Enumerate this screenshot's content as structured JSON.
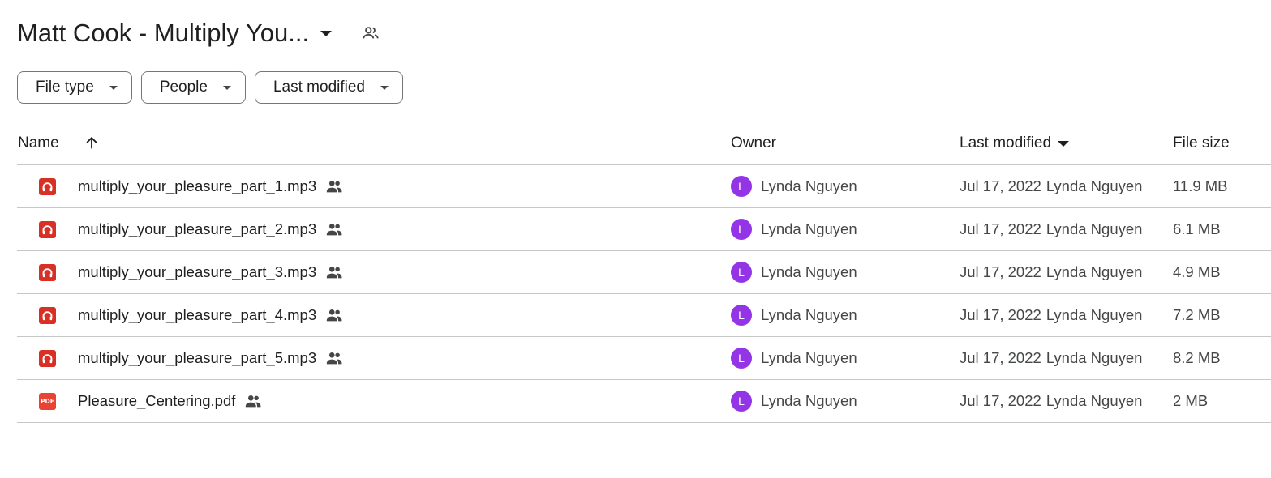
{
  "folder": {
    "title": "Matt Cook - Multiply You..."
  },
  "filters": {
    "file_type": "File type",
    "people": "People",
    "last_modified": "Last modified"
  },
  "columns": {
    "name": "Name",
    "owner": "Owner",
    "last_modified": "Last modified",
    "file_size": "File size"
  },
  "files": [
    {
      "name": "multiply_your_pleasure_part_1.mp3",
      "type": "audio-icon",
      "owner": "Lynda Nguyen",
      "owner_initial": "L",
      "modified": "Jul 17, 2022",
      "modified_by": "Lynda Nguyen",
      "size": "11.9 MB"
    },
    {
      "name": "multiply_your_pleasure_part_2.mp3",
      "type": "audio-icon",
      "owner": "Lynda Nguyen",
      "owner_initial": "L",
      "modified": "Jul 17, 2022",
      "modified_by": "Lynda Nguyen",
      "size": "6.1 MB"
    },
    {
      "name": "multiply_your_pleasure_part_3.mp3",
      "type": "audio-icon",
      "owner": "Lynda Nguyen",
      "owner_initial": "L",
      "modified": "Jul 17, 2022",
      "modified_by": "Lynda Nguyen",
      "size": "4.9 MB"
    },
    {
      "name": "multiply_your_pleasure_part_4.mp3",
      "type": "audio-icon",
      "owner": "Lynda Nguyen",
      "owner_initial": "L",
      "modified": "Jul 17, 2022",
      "modified_by": "Lynda Nguyen",
      "size": "7.2 MB"
    },
    {
      "name": "multiply_your_pleasure_part_5.mp3",
      "type": "audio-icon",
      "owner": "Lynda Nguyen",
      "owner_initial": "L",
      "modified": "Jul 17, 2022",
      "modified_by": "Lynda Nguyen",
      "size": "8.2 MB"
    },
    {
      "name": "Pleasure_Centering.pdf",
      "type": "pdf-icon",
      "icon_label": "PDF",
      "owner": "Lynda Nguyen",
      "owner_initial": "L",
      "modified": "Jul 17, 2022",
      "modified_by": "Lynda Nguyen",
      "size": "2 MB"
    }
  ],
  "colors": {
    "audio_icon": "#d93025",
    "pdf_icon": "#ea4335",
    "avatar": "#9334e6",
    "divider": "#c7c7c7"
  }
}
